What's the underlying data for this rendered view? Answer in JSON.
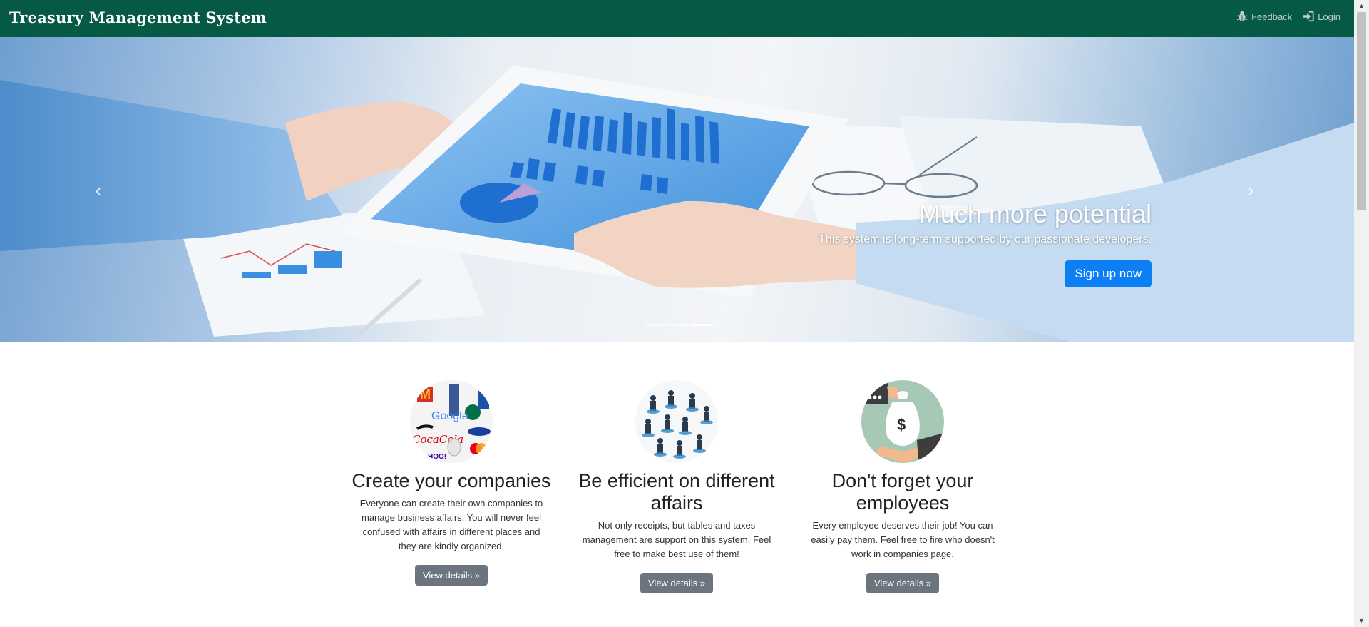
{
  "navbar": {
    "brand": "Treasury Management System",
    "feedback_label": "Feedback",
    "feedback_icon": "bug-icon",
    "login_label": "Login",
    "login_icon": "sign-in-icon",
    "color": "#065a45"
  },
  "carousel": {
    "caption_title": "Much more potential",
    "caption_text": "This system is long-term supported by our passionate developers.",
    "button_label": "Sign up now",
    "prev_icon": "chevron-left-icon",
    "next_icon": "chevron-right-icon",
    "slide_count": 3,
    "active_slide": 3
  },
  "features": [
    {
      "title": "Create your companies",
      "text": "Everyone can create their own companies to manage business affairs. You will never feel confused with affairs in different places and they are kindly organized.",
      "button": "View details »",
      "image": "brand-logos-collage"
    },
    {
      "title": "Be efficient on different affairs",
      "text": "Not only receipts, but tables and taxes management are support on this system. Feel free to make best use of them!",
      "button": "View details »",
      "image": "business-people-figures"
    },
    {
      "title": "Don't forget your employees",
      "text": "Every employee deserves their job! You can easily pay them. Feel free to fire who doesn't work in companies page.",
      "button": "View details »",
      "image": "money-bag-hand"
    }
  ]
}
